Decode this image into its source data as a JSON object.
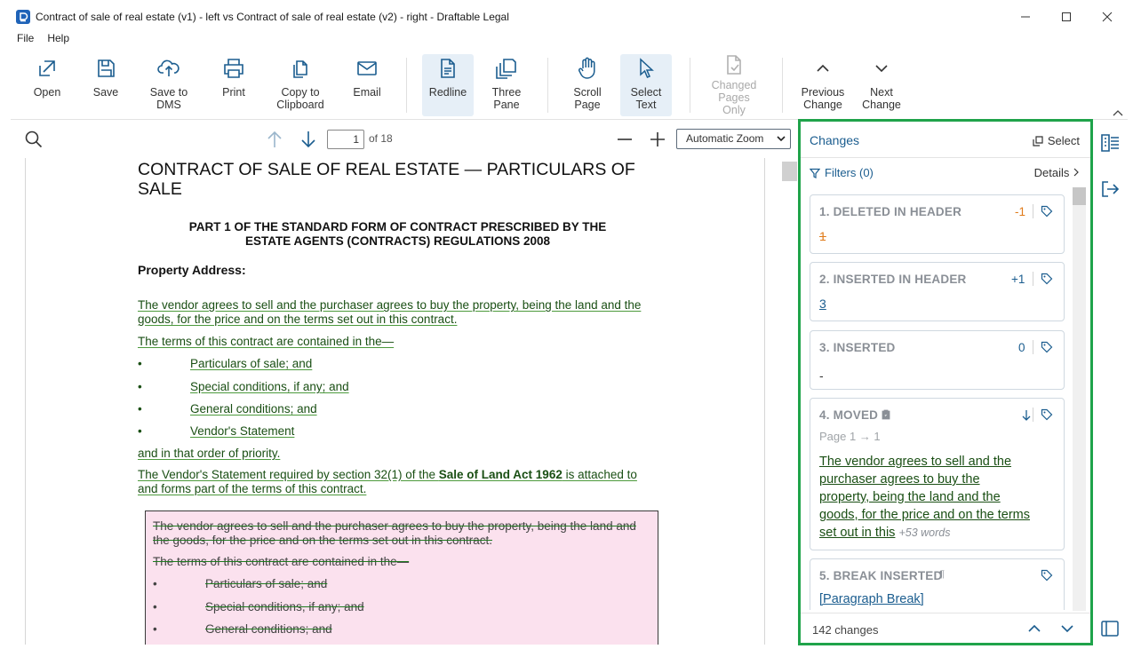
{
  "window": {
    "title": "Contract of sale of real estate (v1) - left vs Contract of sale of real estate (v2) - right - Draftable Legal"
  },
  "menu": {
    "file": "File",
    "help": "Help"
  },
  "toolbar": {
    "open": "Open",
    "save": "Save",
    "save_dms_1": "Save to",
    "save_dms_2": "DMS",
    "print": "Print",
    "copy_1": "Copy to",
    "copy_2": "Clipboard",
    "email": "Email",
    "redline": "Redline",
    "three_1": "Three",
    "three_2": "Pane",
    "scroll_1": "Scroll",
    "scroll_2": "Page",
    "select_1": "Select",
    "select_2": "Text",
    "changed_1": "Changed",
    "changed_2": "Pages Only",
    "prev_1": "Previous",
    "prev_2": "Change",
    "next_1": "Next",
    "next_2": "Change"
  },
  "viewer": {
    "page_number": "1",
    "page_of": "of 18",
    "zoom": "Automatic Zoom"
  },
  "document": {
    "heading": "CONTRACT OF SALE OF REAL ESTATE — PARTICULARS OF SALE",
    "part_heading_1": "PART 1 OF THE STANDARD FORM OF CONTRACT PRESCRIBED BY THE",
    "part_heading_2": "ESTATE AGENTS (CONTRACTS) REGULATIONS 2008",
    "property_address": "Property Address:",
    "ins_para_1": "The vendor agrees to sell and the purchaser agrees to buy the property, being the land and the goods, for the price and on the terms set out in this contract.",
    "ins_para_2": "The terms of this contract are contained in the—",
    "bullet": "•",
    "ins_bullet_1": "Particulars of sale; and",
    "ins_bullet_2": "Special conditions, if any; and",
    "ins_bullet_3": "General conditions; and",
    "ins_bullet_4": "Vendor's Statement",
    "ins_para_3": "and in that order of priority.",
    "ins_para_4a": "The Vendor's Statement required by section 32(1) of the ",
    "ins_para_4b": "Sale of Land Act 1962",
    "ins_para_4c": " is attached to and forms part of the terms of this contract.",
    "del_para_1": "The vendor agrees to sell and the purchaser agrees to buy the property, being the land and the goods, for the price and on the terms set out in this contract.",
    "del_para_2": "The terms of this contract are contained in the—",
    "del_bullet_1": "Particulars of sale; and",
    "del_bullet_2": "Special conditions, if any; and",
    "del_bullet_3": "General conditions; and"
  },
  "changes": {
    "title": "Changes",
    "select": "Select",
    "filters": "Filters (0)",
    "details": "Details",
    "items": [
      {
        "title": "1. DELETED IN HEADER",
        "count": "-1",
        "body": "1"
      },
      {
        "title": "2. INSERTED IN HEADER",
        "count": "+1",
        "body": "3"
      },
      {
        "title": "3. INSERTED",
        "count": "0",
        "body": "-"
      },
      {
        "title": "4. MOVED",
        "subtitle": "Page 1 → 1",
        "lines": [
          "The vendor agrees to sell and the",
          "purchaser agrees to buy the",
          "property, being the land and the",
          "goods, for the price and on the terms",
          "set out in this"
        ],
        "extra": "+53 words"
      },
      {
        "title": "5. BREAK INSERTED",
        "body": "[Paragraph Break]"
      }
    ],
    "footer": "142 changes"
  },
  "colors": {
    "accent": "#1b5d8f",
    "panel_border": "#1fa34a",
    "deleted": "#e07b1a",
    "inserted_text": "#1a4f14",
    "deleted_bg": "#fbe1ee"
  }
}
